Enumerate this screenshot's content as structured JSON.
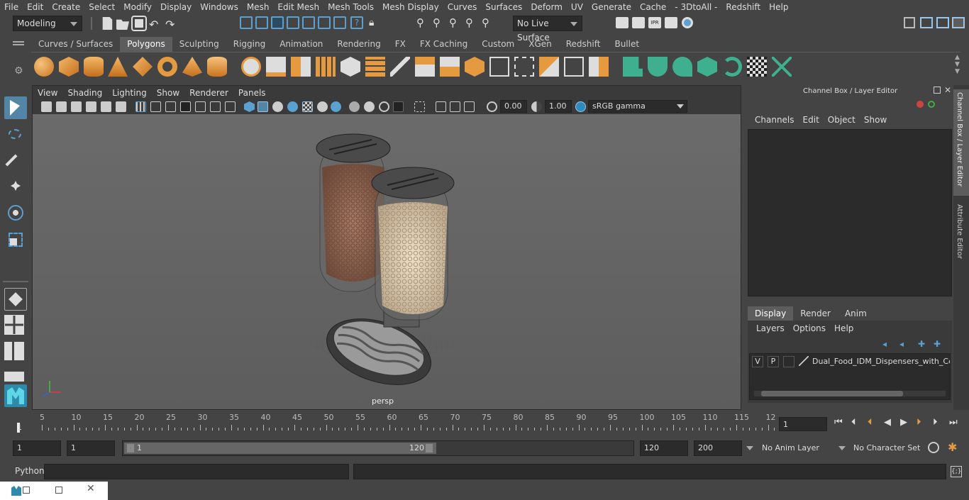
{
  "menubar": [
    "File",
    "Edit",
    "Create",
    "Select",
    "Modify",
    "Display",
    "Windows",
    "Mesh",
    "Edit Mesh",
    "Mesh Tools",
    "Mesh Display",
    "Curves",
    "Surfaces",
    "Deform",
    "UV",
    "Generate",
    "Cache",
    "- 3DtoAll -",
    "Redshift",
    "Help"
  ],
  "status": {
    "mode": "Modeling",
    "live_surface": "No Live Surface"
  },
  "shelf_tabs": [
    "Curves / Surfaces",
    "Polygons",
    "Sculpting",
    "Rigging",
    "Animation",
    "Rendering",
    "FX",
    "FX Caching",
    "Custom",
    "XGen",
    "Redshift",
    "Bullet"
  ],
  "shelf_active": "Polygons",
  "viewport": {
    "menu": [
      "View",
      "Shading",
      "Lighting",
      "Show",
      "Renderer",
      "Panels"
    ],
    "exposure": "0.00",
    "gamma": "1.00",
    "color_space": "sRGB gamma",
    "camera_label": "persp"
  },
  "channel_box": {
    "title": "Channel Box / Layer Editor",
    "menu": [
      "Channels",
      "Edit",
      "Object",
      "Show"
    ],
    "side_tabs": [
      "Channel Box / Layer Editor",
      "Attribute Editor"
    ]
  },
  "layer_editor": {
    "tabs": [
      "Display",
      "Render",
      "Anim"
    ],
    "active_tab": "Display",
    "menu": [
      "Layers",
      "Options",
      "Help"
    ],
    "layer": {
      "v": "V",
      "p": "P",
      "name": "Dual_Food_IDM_Dispensers_with_Cereal"
    }
  },
  "timeline": {
    "ticks": [
      "5",
      "10",
      "15",
      "20",
      "25",
      "30",
      "35",
      "40",
      "45",
      "50",
      "55",
      "60",
      "65",
      "70",
      "75",
      "80",
      "85",
      "90",
      "95",
      "100",
      "105",
      "110",
      "115",
      "12"
    ],
    "start_marker": "1",
    "current_frame": "1"
  },
  "range": {
    "start": "1",
    "anim_start": "1",
    "slider_start": "1",
    "slider_end": "120",
    "end": "120",
    "anim_end": "200",
    "anim_layer": "No Anim Layer",
    "char_set": "No Character Set"
  },
  "cmd": {
    "label": "Python"
  },
  "colors": {
    "bg": "#444444",
    "dark": "#2b2b2b",
    "accent": "#5285a6",
    "shelf_active": "#5d5d5d"
  }
}
